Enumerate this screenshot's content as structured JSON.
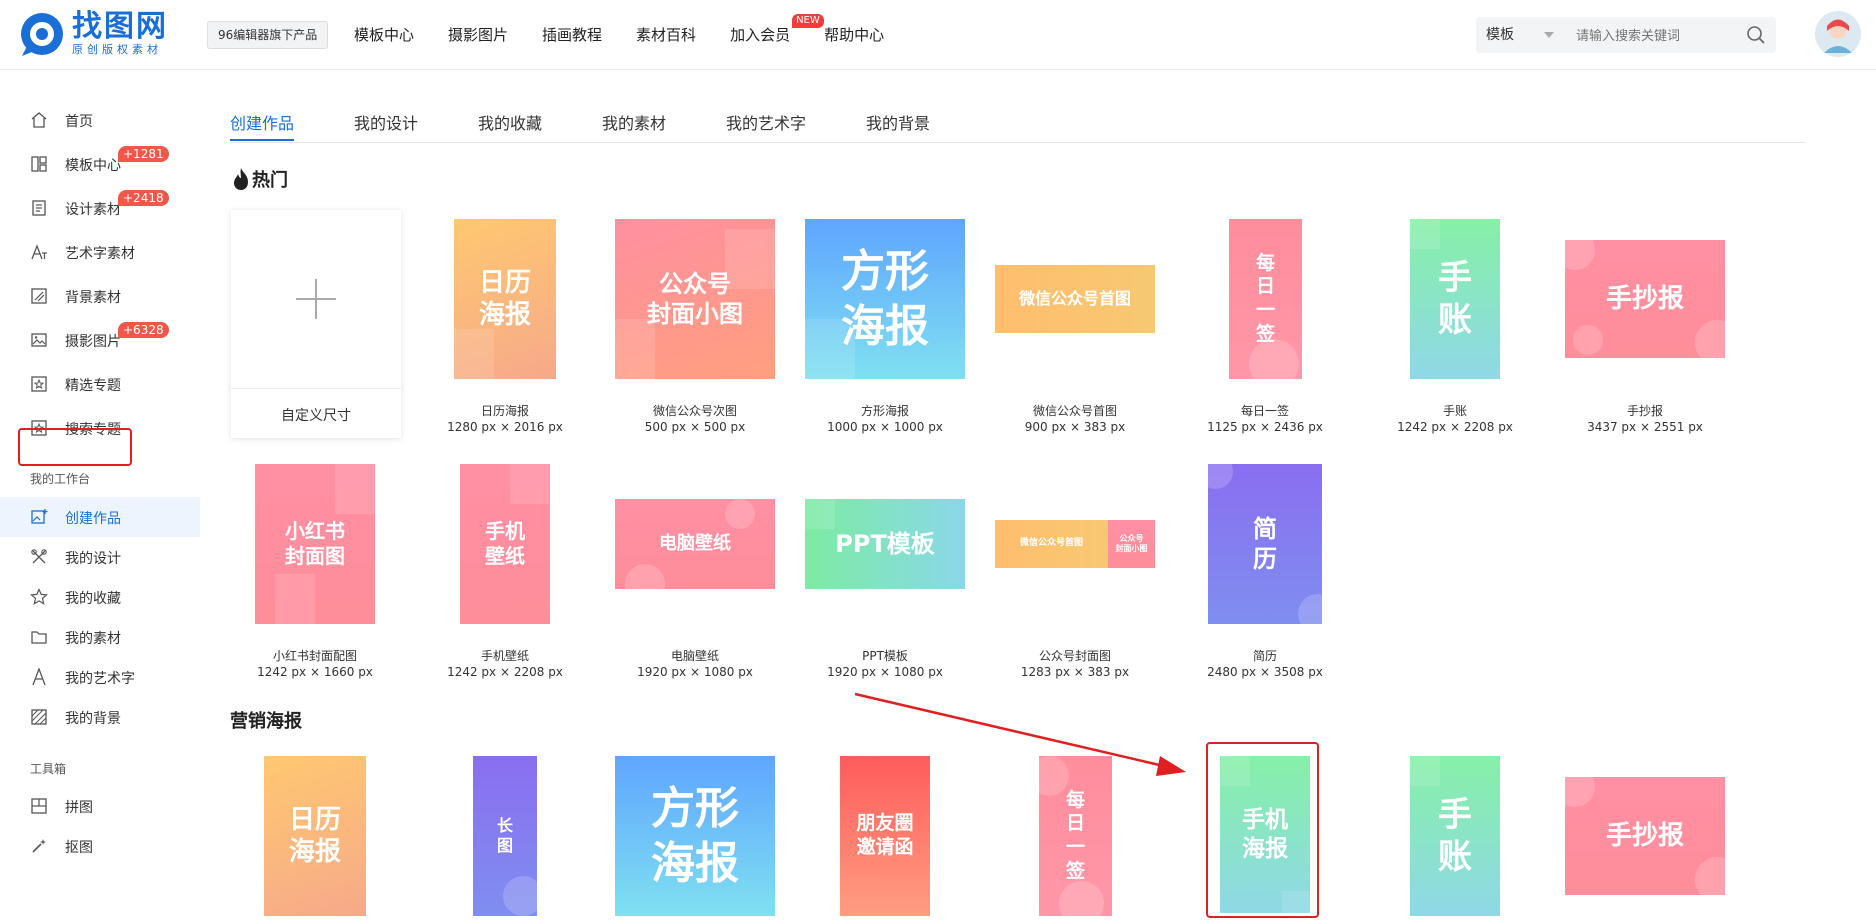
{
  "header": {
    "logo_title": "找图网",
    "logo_sub": "原创版权素材",
    "badge": "96编辑器旗下产品",
    "nav": [
      {
        "label": "模板中心"
      },
      {
        "label": "摄影图片"
      },
      {
        "label": "插画教程"
      },
      {
        "label": "素材百科"
      },
      {
        "label": "加入会员",
        "tag": "NEW"
      },
      {
        "label": "帮助中心"
      }
    ],
    "search": {
      "select": "模板",
      "placeholder": "请输入搜索关键词"
    }
  },
  "sidebar": {
    "items": [
      {
        "label": "首页",
        "icon": "home-icon"
      },
      {
        "label": "模板中心",
        "icon": "template-icon",
        "count": "+1281"
      },
      {
        "label": "设计素材",
        "icon": "design-material-icon",
        "count": "+2418"
      },
      {
        "label": "艺术字素材",
        "icon": "art-text-icon"
      },
      {
        "label": "背景素材",
        "icon": "background-icon"
      },
      {
        "label": "摄影图片",
        "icon": "photo-icon",
        "count": "+6328"
      },
      {
        "label": "精选专题",
        "icon": "featured-topic-icon"
      },
      {
        "label": "搜索专题",
        "icon": "search-topic-icon"
      }
    ],
    "workspace_title": "我的工作台",
    "workspace": [
      {
        "label": "创建作品",
        "icon": "create-work-icon",
        "active": true
      },
      {
        "label": "我的设计",
        "icon": "my-design-icon"
      },
      {
        "label": "我的收藏",
        "icon": "star-icon"
      },
      {
        "label": "我的素材",
        "icon": "folder-icon"
      },
      {
        "label": "我的艺术字",
        "icon": "letter-a-icon"
      },
      {
        "label": "我的背景",
        "icon": "texture-icon"
      }
    ],
    "tools_title": "工具箱",
    "tools": [
      {
        "label": "拼图",
        "icon": "collage-icon"
      },
      {
        "label": "抠图",
        "icon": "magic-wand-icon"
      }
    ]
  },
  "tabs": [
    "创建作品",
    "我的设计",
    "我的收藏",
    "我的素材",
    "我的艺术字",
    "我的背景"
  ],
  "hot": {
    "title": "热门",
    "custom_label": "自定义尺寸",
    "items": [
      {
        "name": "日历海报",
        "size": "1280 px × 2016 px",
        "text": "日历\n海报"
      },
      {
        "name": "微信公众号次图",
        "size": "500 px × 500 px",
        "text": "公众号\n封面小图"
      },
      {
        "name": "方形海报",
        "size": "1000 px × 1000 px",
        "text": "方形\n海报"
      },
      {
        "name": "微信公众号首图",
        "size": "900 px × 383 px",
        "text": "微信公众号首图"
      },
      {
        "name": "每日一签",
        "size": "1125 px × 2436 px",
        "text": "每\n日\n一\n签"
      },
      {
        "name": "手账",
        "size": "1242 px × 2208 px",
        "text": "手\n账"
      },
      {
        "name": "手抄报",
        "size": "3437 px × 2551 px",
        "text": "手抄报"
      },
      {
        "name": "小红书封面配图",
        "size": "1242 px × 1660 px",
        "text": "小红书\n封面图"
      },
      {
        "name": "手机壁纸",
        "size": "1242 px × 2208 px",
        "text": "手机\n壁纸"
      },
      {
        "name": "电脑壁纸",
        "size": "1920 px × 1080 px",
        "text": "电脑壁纸"
      },
      {
        "name": "PPT模板",
        "size": "1920 px × 1080 px",
        "text": "PPT模板"
      },
      {
        "name": "公众号封面图",
        "size": "1283 px × 383 px",
        "text": "微信公众号首图",
        "text2": "公众号\n封面小图"
      },
      {
        "name": "简历",
        "size": "2480 px × 3508 px",
        "text": "简\n历"
      }
    ]
  },
  "marketing": {
    "title": "营销海报",
    "items": [
      {
        "text": "日历\n海报"
      },
      {
        "text": "长\n图"
      },
      {
        "text": "方形\n海报"
      },
      {
        "text": "朋友圈\n邀请函"
      },
      {
        "text": "每\n日\n一\n签"
      },
      {
        "text": "手机\n海报"
      },
      {
        "text": "手\n账"
      },
      {
        "text": "手抄报"
      }
    ]
  }
}
